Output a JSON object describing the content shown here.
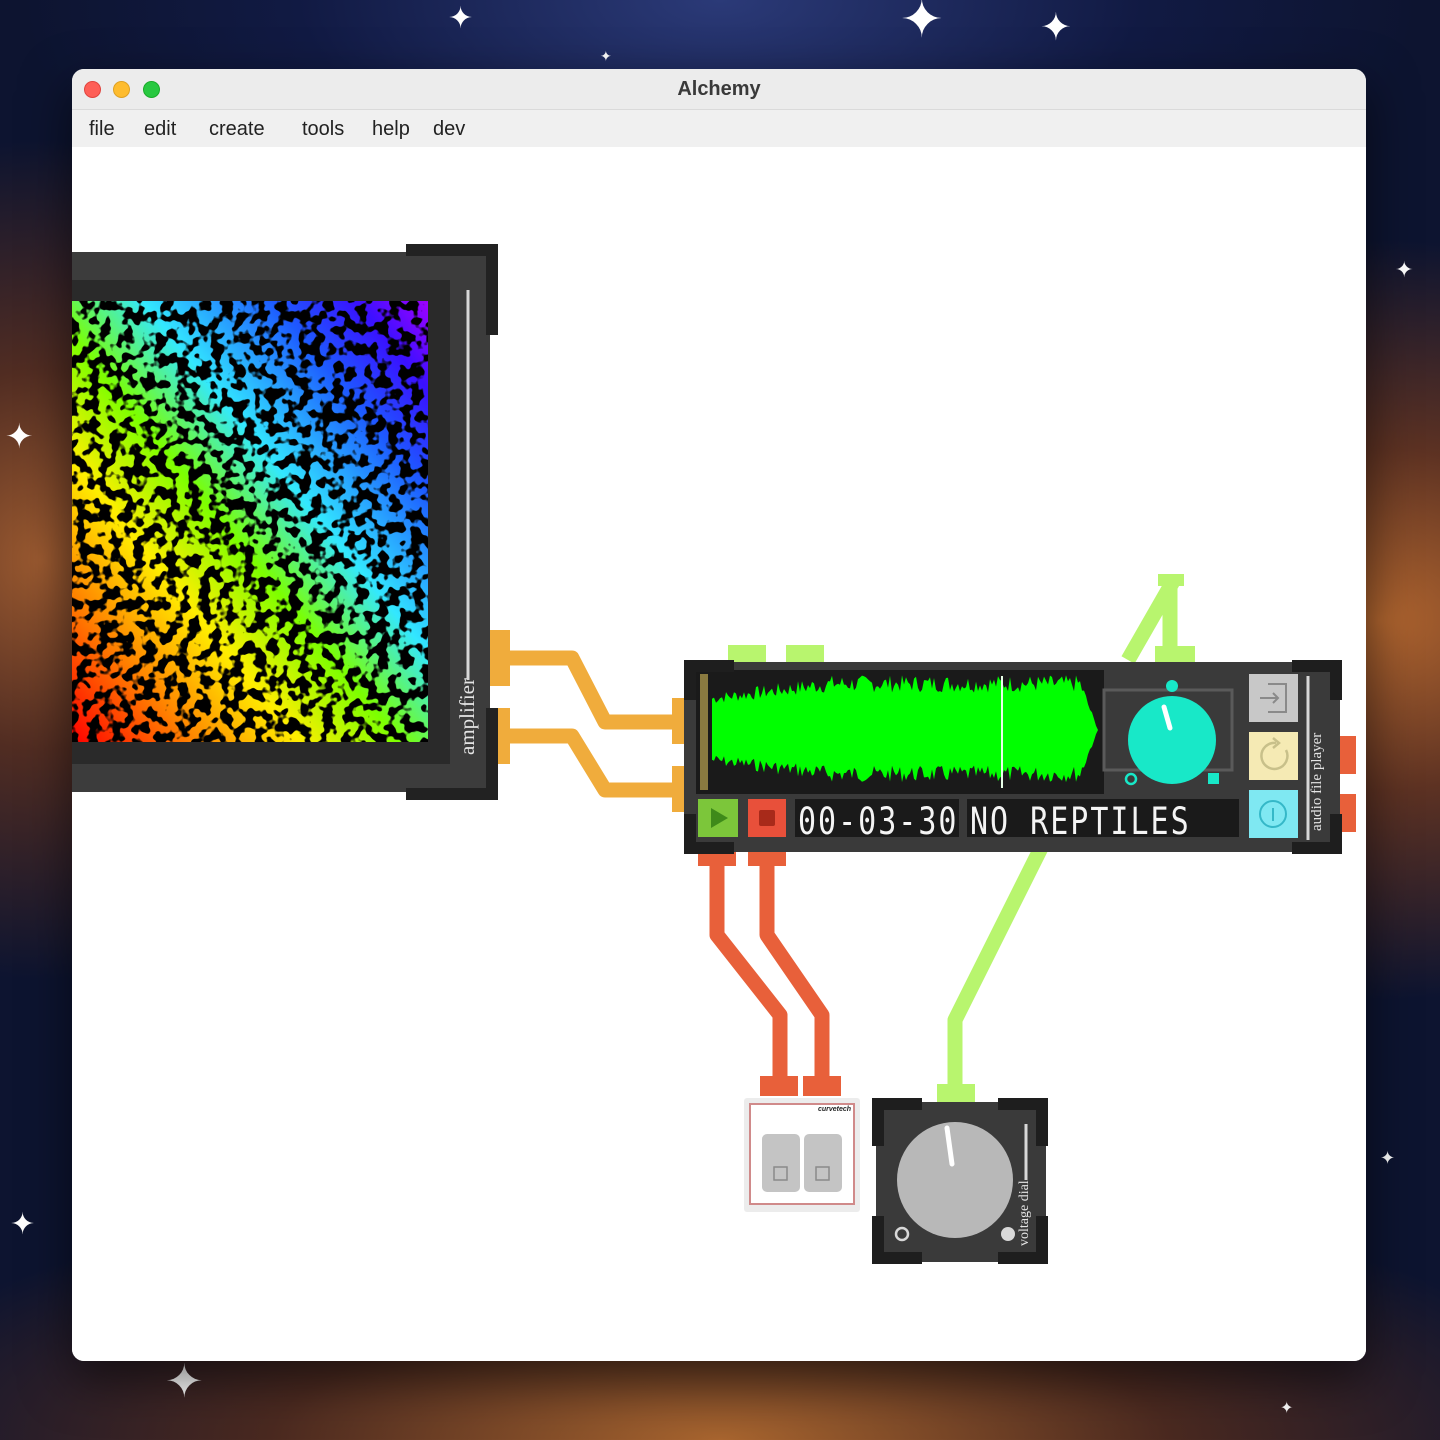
{
  "window": {
    "title": "Alchemy"
  },
  "menu": {
    "items": [
      "file",
      "edit",
      "create",
      "tools",
      "help",
      "dev"
    ]
  },
  "modules": {
    "amplifier": {
      "label": "amplifier"
    },
    "audio_player": {
      "label": "audio file player",
      "time": "00-03-30",
      "track": "NO REPTILES"
    },
    "voltage_dial": {
      "label": "voltage dial"
    },
    "switch": {
      "brand": "curvetech"
    }
  },
  "colors": {
    "cable_orange": "#f0ac3c",
    "cable_red": "#e8603a",
    "cable_green": "#b8f56e",
    "waveform": "#00ff00",
    "knob_teal": "#18e8c8",
    "button_teal": "#7fe8f2",
    "button_yellow": "#f5eab4",
    "play_green": "#7cc63a",
    "stop_red": "#e8503a"
  },
  "icons": [
    "import-icon",
    "loop-icon",
    "info-icon",
    "play-icon",
    "stop-icon"
  ]
}
